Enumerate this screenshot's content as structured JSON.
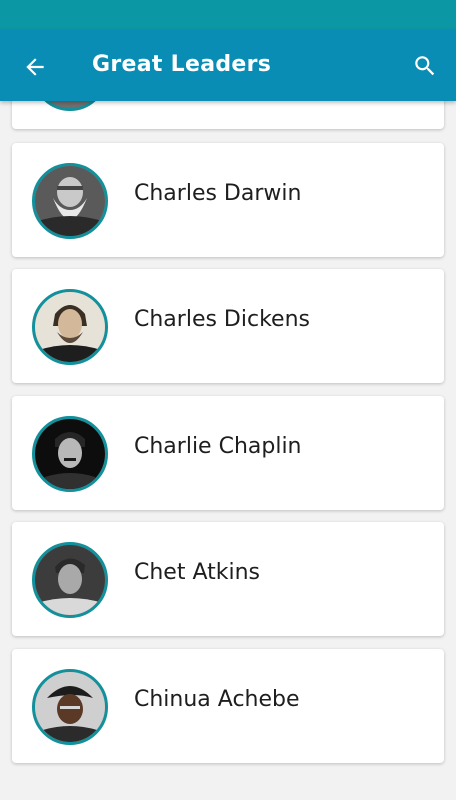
{
  "app_bar": {
    "title": "Great Leaders",
    "back_icon": "arrow-back-icon",
    "search_icon": "search-icon",
    "color": "#0a8db5"
  },
  "status_bar": {
    "color": "#0b97a3"
  },
  "list": {
    "items": [
      {
        "name": "Charles Darwin",
        "avatar": "charles-darwin-portrait"
      },
      {
        "name": "Charles Dickens",
        "avatar": "charles-dickens-portrait"
      },
      {
        "name": "Charlie Chaplin",
        "avatar": "charlie-chaplin-portrait"
      },
      {
        "name": "Chet Atkins",
        "avatar": "chet-atkins-portrait"
      },
      {
        "name": "Chinua Achebe",
        "avatar": "chinua-achebe-portrait"
      }
    ]
  }
}
